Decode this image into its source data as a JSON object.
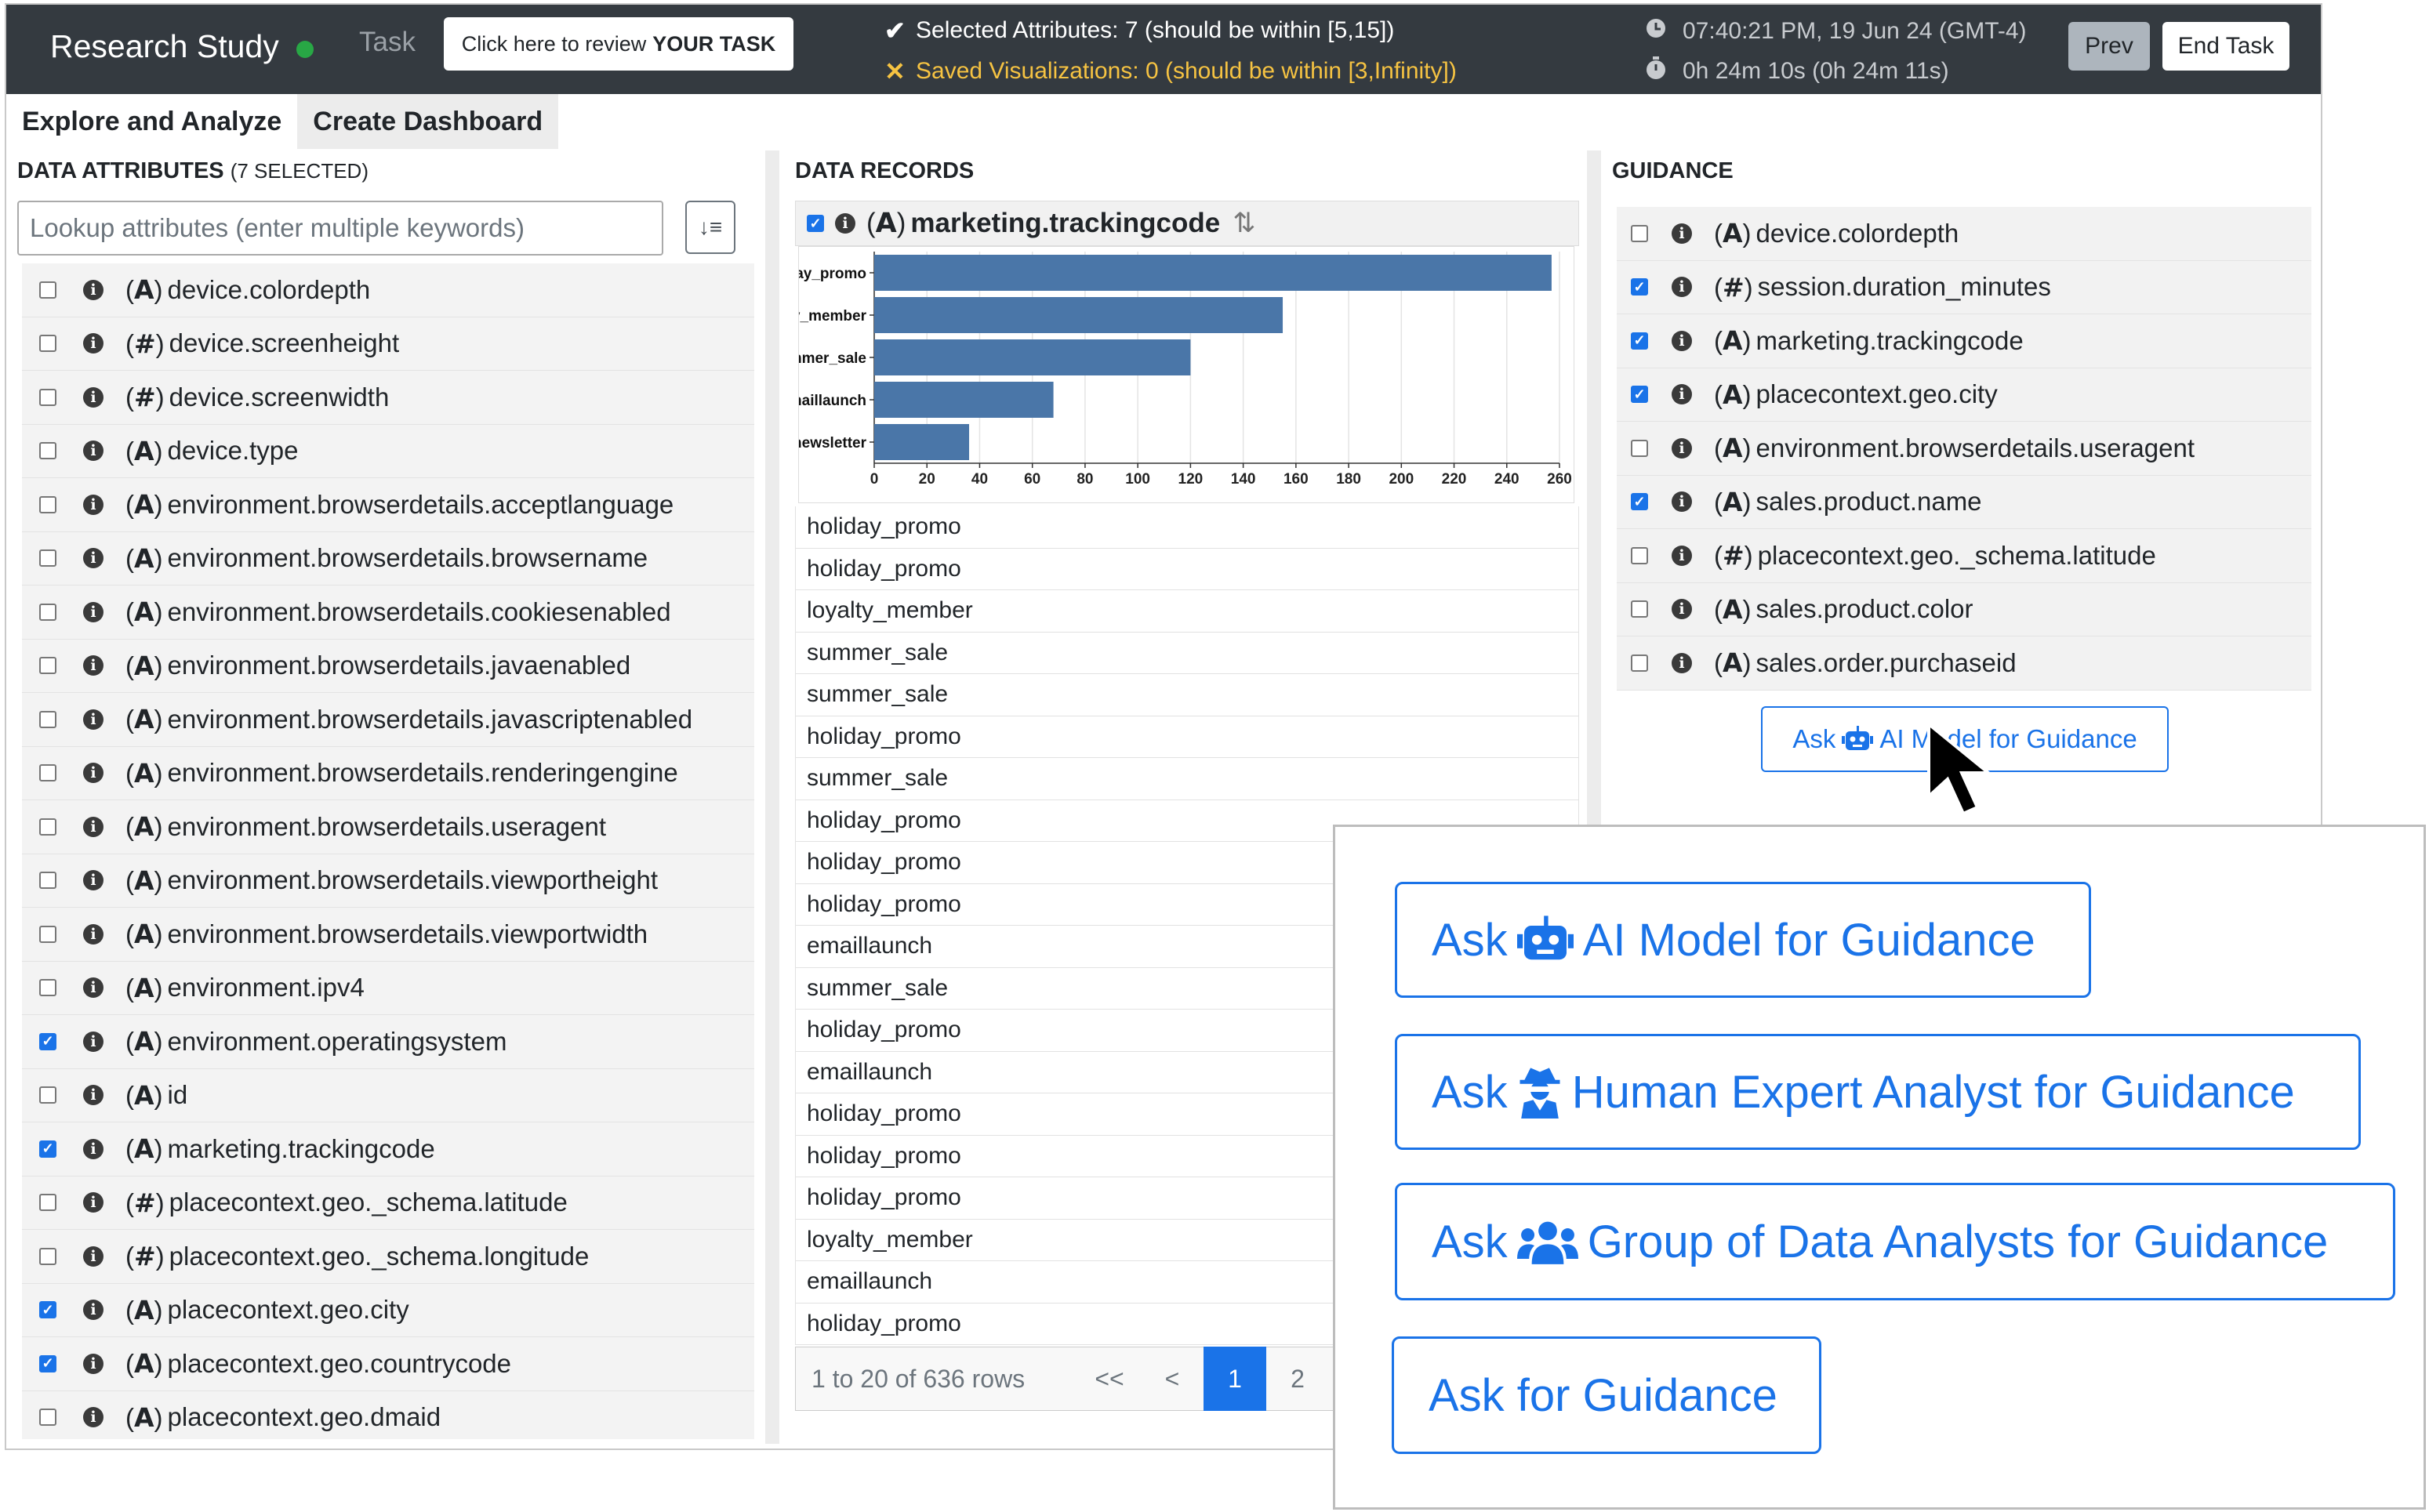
{
  "header": {
    "brand": "Research Study",
    "task_label": "Task",
    "review_prefix": "Click here to review",
    "review_bold": "YOUR TASK",
    "selected_status": "Selected Attributes: 7 (should be within [5,15])",
    "saved_status": "Saved Visualizations: 0 (should be within [3,Infinity])",
    "clock": "07:40:21 PM, 19 Jun 24 (GMT-4)",
    "timer": "0h 24m 10s (0h 24m 11s)",
    "prev_label": "Prev",
    "end_label": "End Task",
    "status_ok_color": "#ffffff",
    "status_warn_color": "#f6c342"
  },
  "tabs": [
    {
      "label": "Explore and Analyze",
      "active": true
    },
    {
      "label": "Create Dashboard",
      "active": false
    }
  ],
  "attributes_panel": {
    "title": "DATA ATTRIBUTES",
    "selected_note": "(7 SELECTED)",
    "search_placeholder": "Lookup attributes (enter multiple keywords)",
    "items": [
      {
        "type": "A",
        "name": "device.colordepth",
        "checked": false
      },
      {
        "type": "#",
        "name": "device.screenheight",
        "checked": false
      },
      {
        "type": "#",
        "name": "device.screenwidth",
        "checked": false
      },
      {
        "type": "A",
        "name": "device.type",
        "checked": false
      },
      {
        "type": "A",
        "name": "environment.browserdetails.acceptlanguage",
        "checked": false
      },
      {
        "type": "A",
        "name": "environment.browserdetails.browsername",
        "checked": false
      },
      {
        "type": "A",
        "name": "environment.browserdetails.cookiesenabled",
        "checked": false
      },
      {
        "type": "A",
        "name": "environment.browserdetails.javaenabled",
        "checked": false
      },
      {
        "type": "A",
        "name": "environment.browserdetails.javascriptenabled",
        "checked": false
      },
      {
        "type": "A",
        "name": "environment.browserdetails.renderingengine",
        "checked": false
      },
      {
        "type": "A",
        "name": "environment.browserdetails.useragent",
        "checked": false
      },
      {
        "type": "A",
        "name": "environment.browserdetails.viewportheight",
        "checked": false
      },
      {
        "type": "A",
        "name": "environment.browserdetails.viewportwidth",
        "checked": false
      },
      {
        "type": "A",
        "name": "environment.ipv4",
        "checked": false
      },
      {
        "type": "A",
        "name": "environment.operatingsystem",
        "checked": true
      },
      {
        "type": "A",
        "name": "id",
        "checked": false
      },
      {
        "type": "A",
        "name": "marketing.trackingcode",
        "checked": true
      },
      {
        "type": "#",
        "name": "placecontext.geo._schema.latitude",
        "checked": false
      },
      {
        "type": "#",
        "name": "placecontext.geo._schema.longitude",
        "checked": false
      },
      {
        "type": "A",
        "name": "placecontext.geo.city",
        "checked": true
      },
      {
        "type": "A",
        "name": "placecontext.geo.countrycode",
        "checked": true
      },
      {
        "type": "A",
        "name": "placecontext.geo.dmaid",
        "checked": false
      }
    ]
  },
  "records_panel": {
    "title": "DATA RECORDS",
    "column": {
      "type": "A",
      "name": "marketing.trackingcode",
      "checked": true
    },
    "rows": [
      "holiday_promo",
      "holiday_promo",
      "loyalty_member",
      "summer_sale",
      "summer_sale",
      "holiday_promo",
      "summer_sale",
      "holiday_promo",
      "holiday_promo",
      "holiday_promo",
      "emaillaunch",
      "summer_sale",
      "holiday_promo",
      "emaillaunch",
      "holiday_promo",
      "holiday_promo",
      "holiday_promo",
      "loyalty_member",
      "emaillaunch",
      "holiday_promo"
    ],
    "pagination": {
      "summary": "1 to 20 of 636 rows",
      "first": "<<",
      "prev": "<",
      "pages": [
        "1",
        "2"
      ],
      "current": "1"
    }
  },
  "chart_data": {
    "type": "bar",
    "orientation": "horizontal",
    "categories": [
      "holiday_promo",
      "loyalty_member",
      "summer_sale",
      "emaillaunch",
      "newsletter"
    ],
    "values": [
      257,
      155,
      120,
      68,
      36
    ],
    "xlim": [
      0,
      260
    ],
    "xticks": [
      "0",
      "20",
      "40",
      "60",
      "80",
      "100",
      "120",
      "140",
      "160",
      "180",
      "200",
      "220",
      "240",
      "260"
    ],
    "grid": true,
    "bar_color": "#4a76a8"
  },
  "guidance_panel": {
    "title": "GUIDANCE",
    "items": [
      {
        "type": "A",
        "name": "device.colordepth",
        "checked": false
      },
      {
        "type": "#",
        "name": "session.duration_minutes",
        "checked": true
      },
      {
        "type": "A",
        "name": "marketing.trackingcode",
        "checked": true
      },
      {
        "type": "A",
        "name": "placecontext.geo.city",
        "checked": true
      },
      {
        "type": "A",
        "name": "environment.browserdetails.useragent",
        "checked": false
      },
      {
        "type": "A",
        "name": "sales.product.name",
        "checked": true
      },
      {
        "type": "#",
        "name": "placecontext.geo._schema.latitude",
        "checked": false
      },
      {
        "type": "A",
        "name": "sales.product.color",
        "checked": false
      },
      {
        "type": "A",
        "name": "sales.order.purchaseid",
        "checked": false
      }
    ],
    "ask_button": {
      "pre": "Ask",
      "post": "AI Model for Guidance"
    }
  },
  "overlay": {
    "buttons": [
      {
        "pre": "Ask",
        "icon": "robot-icon",
        "post": "AI Model for Guidance"
      },
      {
        "pre": "Ask",
        "icon": "user-secret-icon",
        "post": "Human Expert Analyst for Guidance"
      },
      {
        "pre": "Ask",
        "icon": "users-icon",
        "post": "Group of Data Analysts for Guidance"
      },
      {
        "pre": "",
        "icon": "",
        "post": "Ask for Guidance"
      }
    ],
    "accent_color": "#1a73e8"
  }
}
